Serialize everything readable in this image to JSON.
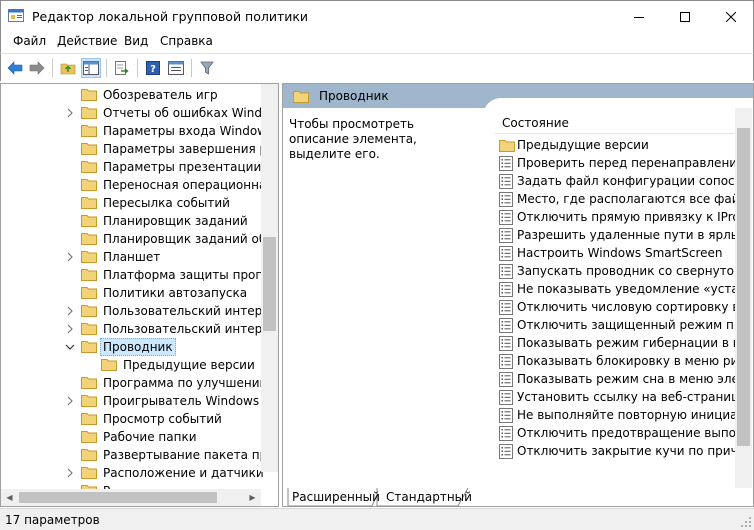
{
  "window": {
    "title": "Редактор локальной групповой политики"
  },
  "menu": {
    "items": [
      "Файл",
      "Действие",
      "Вид",
      "Справка"
    ]
  },
  "toolbar": {
    "icons": [
      "back-arrow-icon",
      "forward-arrow-icon",
      "up-folder-icon",
      "show-hide-tree-icon",
      "export-list-icon",
      "help-icon",
      "properties-icon",
      "filter-icon"
    ]
  },
  "tree": {
    "items": [
      {
        "label": "Обозреватель игр",
        "indent": 0,
        "expand": "none"
      },
      {
        "label": "Отчеты об ошибках Windows",
        "indent": 0,
        "expand": "collapsed"
      },
      {
        "label": "Параметры входа Windows",
        "indent": 0,
        "expand": "none"
      },
      {
        "label": "Параметры завершения работы",
        "indent": 0,
        "expand": "none"
      },
      {
        "label": "Параметры презентации",
        "indent": 0,
        "expand": "none"
      },
      {
        "label": "Переносная операционная система",
        "indent": 0,
        "expand": "none"
      },
      {
        "label": "Пересылка событий",
        "indent": 0,
        "expand": "none"
      },
      {
        "label": "Планировщик заданий",
        "indent": 0,
        "expand": "none"
      },
      {
        "label": "Планировщик заданий обслуживания",
        "indent": 0,
        "expand": "none"
      },
      {
        "label": "Планшет",
        "indent": 0,
        "expand": "collapsed"
      },
      {
        "label": "Платформа защиты программного обеспечения",
        "indent": 0,
        "expand": "none"
      },
      {
        "label": "Политики автозапуска",
        "indent": 0,
        "expand": "none"
      },
      {
        "label": "Пользовательский интерфейс",
        "indent": 0,
        "expand": "collapsed"
      },
      {
        "label": "Пользовательский интерфейс",
        "indent": 0,
        "expand": "collapsed"
      },
      {
        "label": "Проводник",
        "indent": 0,
        "expand": "expanded",
        "selected": true
      },
      {
        "label": "Предыдущие версии",
        "indent": 1,
        "expand": "none"
      },
      {
        "label": "Программа по улучшению",
        "indent": 0,
        "expand": "none"
      },
      {
        "label": "Проигрыватель Windows Media",
        "indent": 0,
        "expand": "collapsed"
      },
      {
        "label": "Просмотр событий",
        "indent": 0,
        "expand": "none"
      },
      {
        "label": "Рабочие папки",
        "indent": 0,
        "expand": "none"
      },
      {
        "label": "Развертывание пакета приложений",
        "indent": 0,
        "expand": "none"
      },
      {
        "label": "Расположение и датчики",
        "indent": 0,
        "expand": "collapsed"
      },
      {
        "label": "Р",
        "indent": 0,
        "expand": "none"
      }
    ]
  },
  "details": {
    "header_title": "Проводник",
    "description": "Чтобы просмотреть описание элемента, выделите его.",
    "column_header": "Состояние",
    "items": [
      {
        "label": "Предыдущие версии",
        "kind": "folder"
      },
      {
        "label": "Проверить перед перенаправлением, установлен ли",
        "kind": "setting"
      },
      {
        "label": "Задать файл конфигурации сопоставлений",
        "kind": "setting"
      },
      {
        "label": "Место, где располагаются все файлы описаний",
        "kind": "setting"
      },
      {
        "label": "Отключить прямую привязку к IPropertySetStorage",
        "kind": "setting"
      },
      {
        "label": "Разрешить удаленные пути в ярлыках файлов",
        "kind": "setting"
      },
      {
        "label": "Настроить Windows SmartScreen",
        "kind": "setting"
      },
      {
        "label": "Запускать проводник со свернутой лентой",
        "kind": "setting"
      },
      {
        "label": "Не показывать уведомление «установлено новое»",
        "kind": "setting"
      },
      {
        "label": "Отключить числовую сортировку в проводнике",
        "kind": "setting"
      },
      {
        "label": "Отключить защищенный режим протокола оболочки",
        "kind": "setting"
      },
      {
        "label": "Показывать режим гибернации в меню",
        "kind": "setting"
      },
      {
        "label": "Показывать блокировку в меню рисунка",
        "kind": "setting"
      },
      {
        "label": "Показывать режим сна в меню электропитания",
        "kind": "setting"
      },
      {
        "label": "Установить ссылку на веб-страницу поддержки",
        "kind": "setting"
      },
      {
        "label": "Не выполняйте повторную инициализацию",
        "kind": "setting"
      },
      {
        "label": "Отключить предотвращение выполнения данных",
        "kind": "setting"
      },
      {
        "label": "Отключить закрытие кучи по причине",
        "kind": "setting"
      }
    ]
  },
  "tabs": {
    "extended": "Расширенный",
    "standard": "Стандартный"
  },
  "status": {
    "text": "17 параметров"
  }
}
